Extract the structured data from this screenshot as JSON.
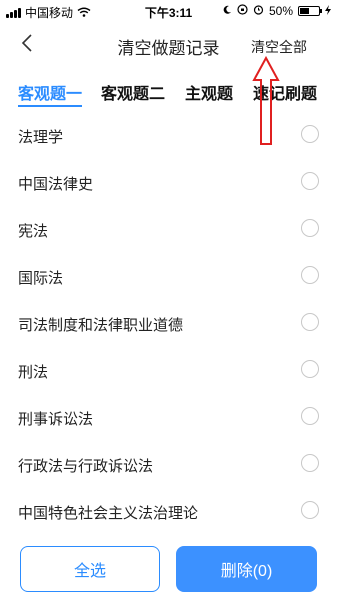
{
  "status": {
    "carrier": "中国移动",
    "time": "下午3:11",
    "battery": "50%"
  },
  "nav": {
    "title": "清空做题记录",
    "action": "清空全部"
  },
  "tabs": [
    "客观题一",
    "客观题二",
    "主观题",
    "速记刷题"
  ],
  "items": [
    "法理学",
    "中国法律史",
    "宪法",
    "国际法",
    "司法制度和法律职业道德",
    "刑法",
    "刑事诉讼法",
    "行政法与行政诉讼法",
    "中国特色社会主义法治理论"
  ],
  "bottom": {
    "select_all": "全选",
    "delete": "删除(0)"
  },
  "colors": {
    "accent": "#2b8cff",
    "annotation_arrow": "#e02020"
  }
}
